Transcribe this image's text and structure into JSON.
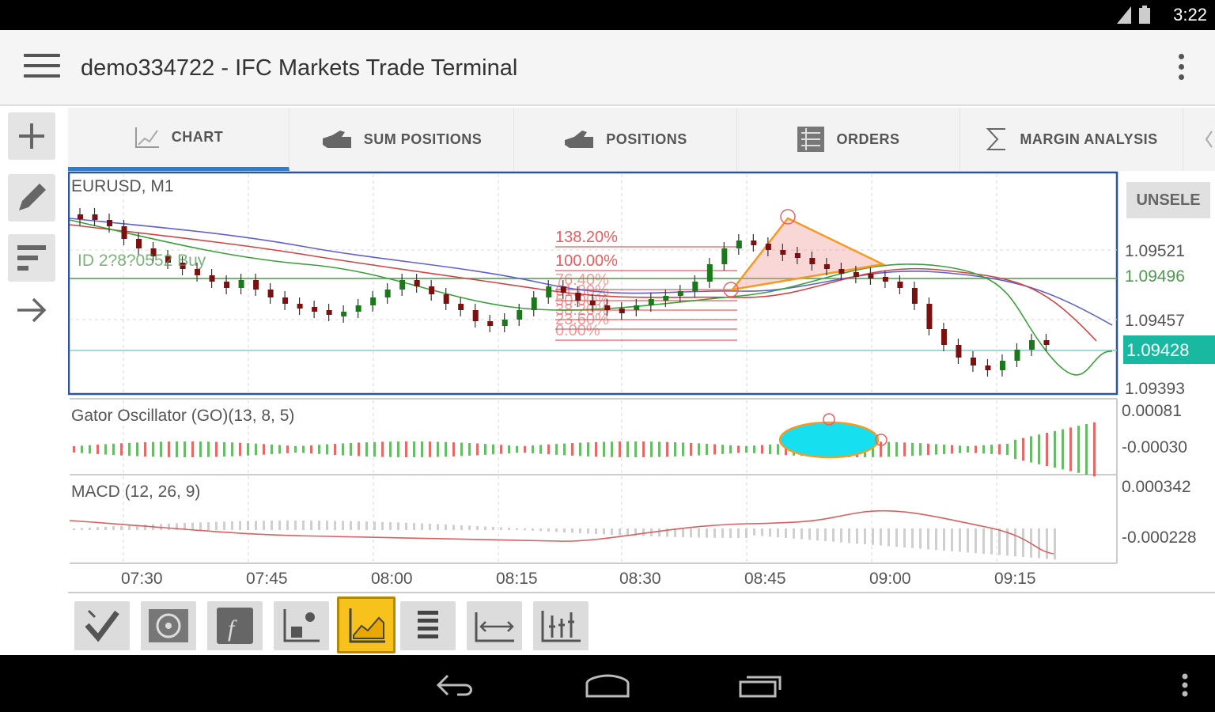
{
  "status": {
    "time": "3:22"
  },
  "app": {
    "title": "demo334722 - IFC Markets Trade Terminal"
  },
  "tabs": [
    {
      "label": "CHART",
      "icon": "line-chart-icon",
      "active": true
    },
    {
      "label": "SUM POSITIONS",
      "icon": "hand-icon",
      "active": false
    },
    {
      "label": "POSITIONS",
      "icon": "hand-icon",
      "active": false
    },
    {
      "label": "ORDERS",
      "icon": "list-icon",
      "active": false
    },
    {
      "label": "MARGIN ANALYSIS",
      "icon": "sigma-icon",
      "active": false
    }
  ],
  "chart": {
    "symbol_label": "EURUSD, M1",
    "unselect_label": "UNSELE",
    "position_label": "ID 2?8?0552 Buy",
    "price_ticks": [
      "1.09521",
      "1.09496",
      "1.09457",
      "1.09428",
      "1.09393"
    ],
    "current_price": "1.09428",
    "fib_labels": [
      "138.20%",
      "100.00%",
      "76.40%",
      "61.80%",
      "50.00%",
      "38.20%",
      "23.60%",
      "0.00%"
    ],
    "gator_label": "Gator Oscillator (GO)(13, 8, 5)",
    "gator_ticks": [
      "0.00081",
      "-0.00030"
    ],
    "macd_label": "MACD (12, 26, 9)",
    "macd_ticks": [
      "0.000342",
      "-0.000228"
    ],
    "time_ticks": [
      "07:30",
      "07:45",
      "08:00",
      "08:15",
      "08:30",
      "08:45",
      "09:00",
      "09:15"
    ],
    "colors": {
      "up": "#1a7a1a",
      "down": "#7a1010",
      "accent": "#2a7fd4",
      "price_badge": "#18b9a0",
      "fib": "#e84a4a",
      "triangle": "#f59a23"
    }
  },
  "chart_data": {
    "type": "line",
    "title": "EURUSD, M1",
    "x": [
      "07:30",
      "07:45",
      "08:00",
      "08:15",
      "08:30",
      "08:45",
      "09:00",
      "09:15"
    ],
    "y_ticks": [
      1.09521,
      1.09496,
      1.09457,
      1.09428,
      1.09393
    ],
    "close": [
      1.0952,
      1.0949,
      1.0946,
      1.0947,
      1.0949,
      1.0951,
      1.095,
      1.0942
    ],
    "ylim": [
      1.0939,
      1.0956
    ],
    "grid": true,
    "indicators": [
      "Gator Oscillator (GO)(13, 8, 5)",
      "MACD (12, 26, 9)"
    ]
  },
  "bottom_tools": [
    {
      "name": "trade-tool",
      "icon": "check-icon",
      "active": false
    },
    {
      "name": "indicator-tool",
      "icon": "target-icon",
      "active": false
    },
    {
      "name": "function-tool",
      "icon": "function-icon",
      "active": false
    },
    {
      "name": "object-tool",
      "icon": "chart-plus-icon",
      "active": false
    },
    {
      "name": "chart-type-tool",
      "icon": "area-chart-icon",
      "active": true
    },
    {
      "name": "list-tool",
      "icon": "list-icon",
      "active": false
    },
    {
      "name": "scale-tool",
      "icon": "width-icon",
      "active": false
    },
    {
      "name": "bars-tool",
      "icon": "bars-icon",
      "active": false
    }
  ]
}
